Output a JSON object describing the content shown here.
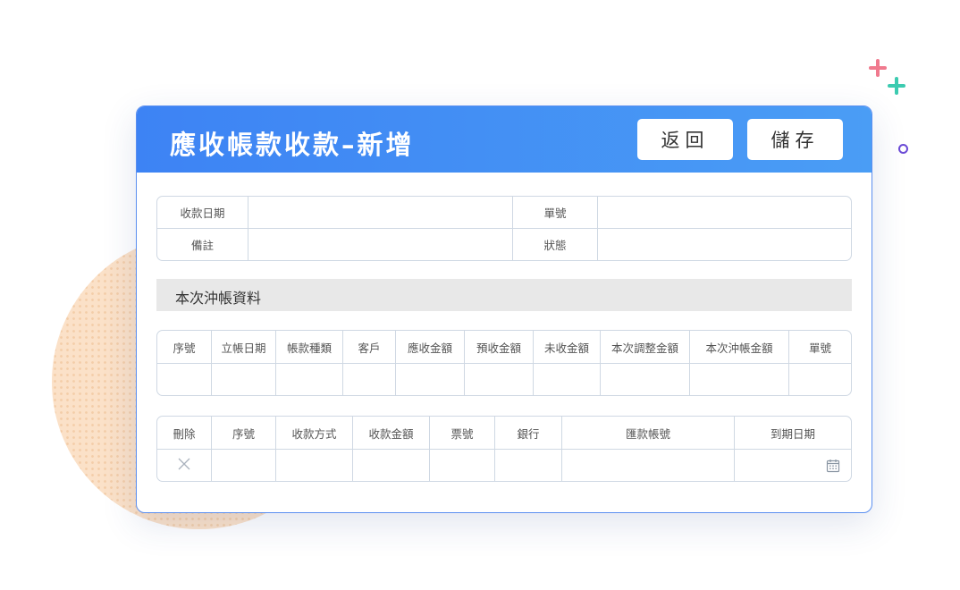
{
  "form": {
    "title": "應收帳款收款–新增",
    "back_label": "返回",
    "save_label": "儲存"
  },
  "info_fields": {
    "receipt_date_label": "收款日期",
    "doc_no_label": "單號",
    "memo_label": "備註",
    "status_label": "狀態"
  },
  "section": {
    "title": "本次沖帳資料"
  },
  "offset_table": {
    "headers": [
      "序號",
      "立帳日期",
      "帳款種類",
      "客戶",
      "應收金額",
      "預收金額",
      "未收金額",
      "本次調整金額",
      "本次沖帳金額",
      "單號"
    ]
  },
  "payment_table": {
    "headers": [
      "刪除",
      "序號",
      "收款方式",
      "收款金額",
      "票號",
      "銀行",
      "匯款帳號",
      "到期日期"
    ]
  },
  "colors": {
    "header_blue": "#3d83f4",
    "border": "#cfd8e3",
    "blob": "#fbe1c8",
    "plus_pink": "#f07a8e",
    "plus_teal": "#3ccbb0",
    "ring_purple": "#6b4bd6"
  },
  "icons": {
    "delete": "close-icon",
    "date": "calendar-icon"
  }
}
